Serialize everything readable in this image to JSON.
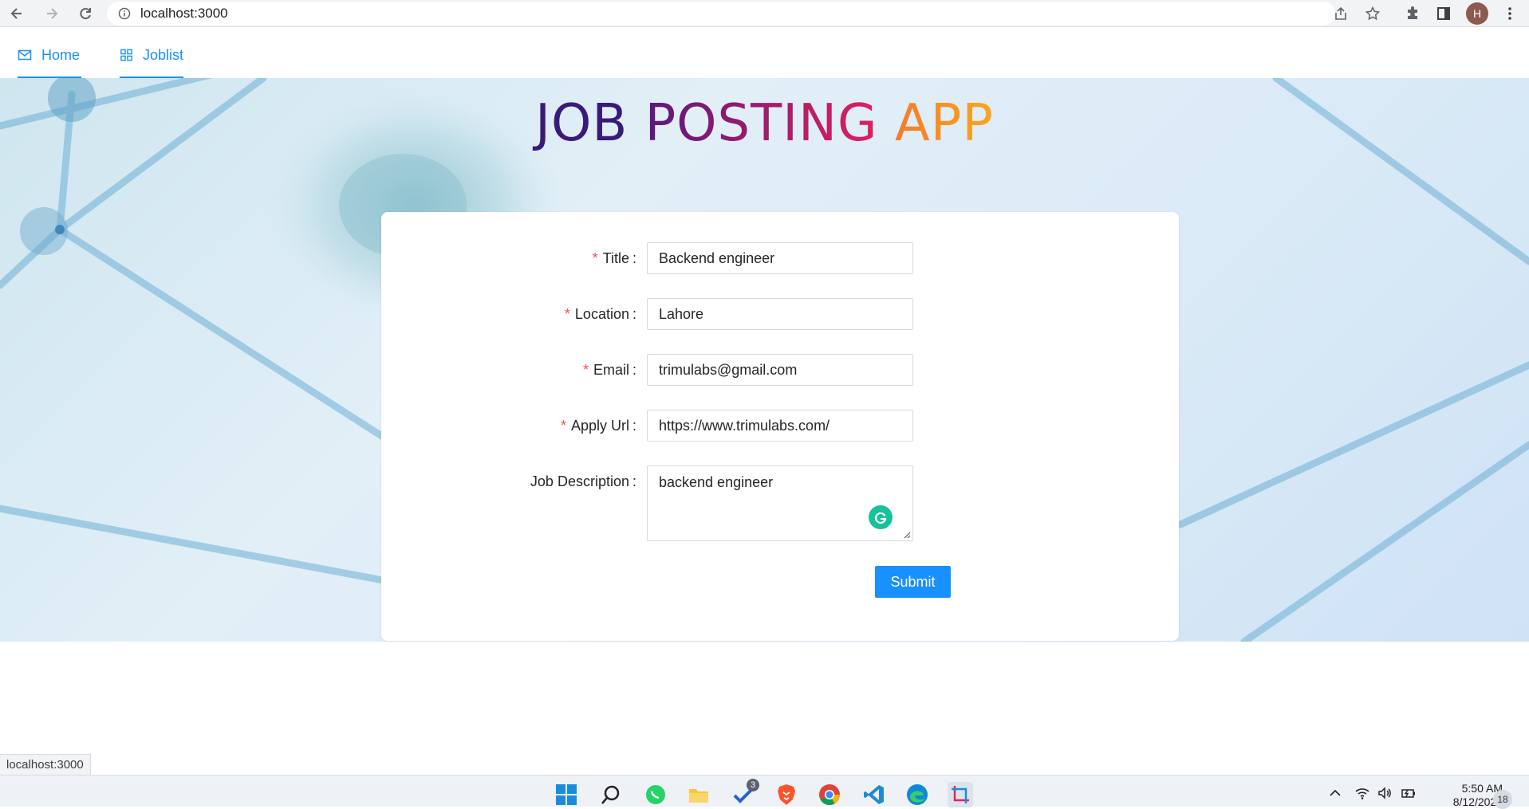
{
  "browser": {
    "url": "localhost:3000",
    "avatar_initial": "H",
    "status_url": "localhost:3000"
  },
  "menu": {
    "items": [
      {
        "label": "Home",
        "icon": "mail-icon"
      },
      {
        "label": "Joblist",
        "icon": "appstore-icon"
      }
    ],
    "active_color": "#1890ff"
  },
  "app": {
    "title_parts": [
      "JOB",
      "POSTING",
      "APP"
    ],
    "title_colors": [
      "#3a1a78",
      "#a3166f",
      "#f08a2a"
    ]
  },
  "form": {
    "fields": [
      {
        "label": "Title",
        "required": true,
        "value": "Backend engineer"
      },
      {
        "label": "Location",
        "required": true,
        "value": "Lahore"
      },
      {
        "label": "Email",
        "required": true,
        "value": "trimulabs@gmail.com"
      },
      {
        "label": "Apply Url",
        "required": true,
        "value": "https://www.trimulabs.com/"
      },
      {
        "label": "Job Description",
        "required": false,
        "value": "backend engineer"
      }
    ],
    "submit_label": "Submit",
    "required_mark": "*",
    "colon": ":"
  },
  "taskbar": {
    "todo_badge": "3",
    "time": "5:50 AM",
    "date": "8/12/2022",
    "notification_count": "18"
  },
  "colors": {
    "primary": "#1890ff",
    "required": "#ff4d4f",
    "grammarly": "#15c39a"
  }
}
